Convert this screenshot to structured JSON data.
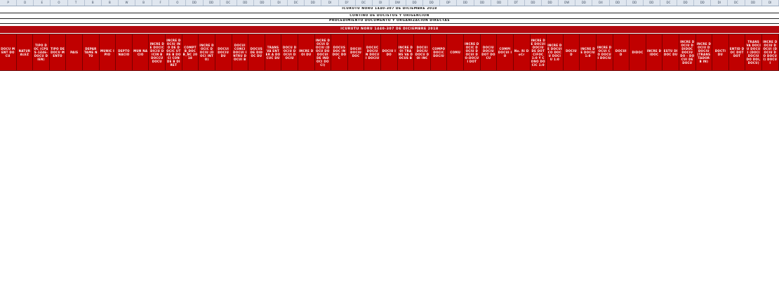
{
  "sheet": {
    "title_top": "ICURUTU NORU 1440-307 DE DICIEMBRE 2018",
    "subtitle_1": "CONTIÑO DE DOCISTOS Y ORIGENCIÓN",
    "subtitle_2": "PROCEDIMIENTO DOCUMENTO Y ORGANIZACION DIRECTAS",
    "band_title": "ICURUTU NORU 1440-307 DE DICIEMBRE 2018"
  },
  "column_letters": [
    "P",
    "D",
    "E",
    "O",
    "T",
    "B",
    "B",
    "W",
    "B",
    "F",
    "O",
    "DD",
    "DD",
    "DC",
    "DD",
    "DD",
    "DI",
    "DC",
    "DD",
    "DI",
    "D?",
    "DC",
    "DI",
    "DW",
    "DD",
    "DD",
    "DP",
    "DD",
    "DD",
    "DD",
    "DT",
    "DD",
    "DD",
    "DW",
    "DD",
    "D4",
    "DD",
    "DD",
    "DD",
    "DC",
    "DD",
    "DD",
    "DI",
    "DC",
    "DD",
    "DI"
  ],
  "headers": [
    "DOCU MENT DOCU",
    "NATUR ALEZ",
    "TIPO DOC (CPSS-1446-DOCU DIEN)",
    "TIPO DE DOCU MENTO",
    "PAIS",
    "DEPAR TAME NTO",
    "MUNIC IPIO",
    "DEPTO NACIO",
    "MUN NACIO",
    "INCRE DE DOCIC DICIU DICIN B DOCCU DOCU",
    "INCRE DOCIU INO DE DOCIC UTRE B DOCI CONDE B DIRET",
    "COMPT B_DOC B_NC 2018",
    "INCRE DOCIC DOCIU (DOCI INTO)",
    "DOCUI DOCIU DU",
    "DOCUI CONCI DOCUI INTRU DOCUI B",
    "DOCUS DE DIDOC DU",
    "TRANS VA ENTER A DOCUC DU",
    "DOCU DOCIU DOCUI DOCIU",
    "INCRE DOI DU",
    "INCRE DOCUI DOCIU (DOCU DO DOCUI DE INDOCI DOCI)",
    "DOCUS DOC INDOC DOC",
    "DOCUI DOCIU DOC",
    "DOCUC DOCIU N DOCUI DOCIU",
    "DOCIU IDO",
    "INCRE DOI TRANS VA DOCUS B",
    "DOCUI DOCIU DOCU DOI INC",
    "COMPO DOCIC DOCIU",
    "COMU",
    "INCRE DOCIC DOCIU DOCUI DO-DOCUI DOT",
    "DOCIU DOCIU DOT DOCU",
    "COMPI DOCUI IO",
    "No. Ri DoCr",
    "INCRE DE DOCUI DOCIU DE DOT CIFOC 1:0 Y CONO DOCIC 1:0",
    "INCRE DE DOCUI CO DOCU DOCIU 1:0",
    "DOCIU D",
    "INCRE DE DOCIU 1:0",
    "INCRE DOCUI CO DOCUI DOCIU",
    "DOCUI D",
    "DIDOC",
    "INCRE DIDOC",
    "ESTU DIDOC DU",
    "INCRE DOCIU D DIDOC DOCIU DO - DOCUI DE DOCU",
    "INCRE DOCIU D DOCIU (TRANS TADOR B IN)",
    "DOCTI DU",
    "ENTID DOC DOT DOT",
    "TRANS VA DOCIU DOCUI (DOCI DOCIU DO DOI, DOCU)",
    "INCRE DOCIU DOCUI (DOCIU DO DOCUI) DOCUI"
  ]
}
